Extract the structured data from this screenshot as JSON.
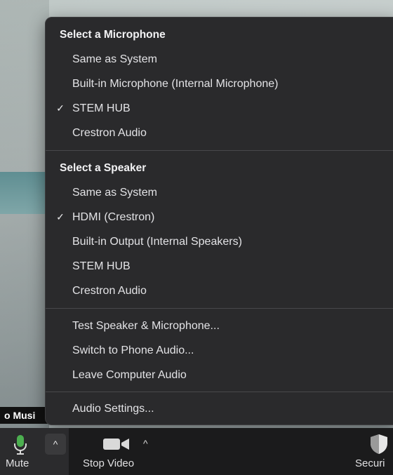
{
  "participant": {
    "name_tag": "o Musi"
  },
  "menu": {
    "microphone_section": {
      "title": "Select a Microphone",
      "items": [
        {
          "label": "Same as System",
          "checked": false
        },
        {
          "label": "Built-in Microphone (Internal Microphone)",
          "checked": false
        },
        {
          "label": "STEM HUB",
          "checked": true
        },
        {
          "label": "Crestron Audio",
          "checked": false
        }
      ]
    },
    "speaker_section": {
      "title": "Select a Speaker",
      "items": [
        {
          "label": "Same as System",
          "checked": false
        },
        {
          "label": "HDMI (Crestron)",
          "checked": true
        },
        {
          "label": "Built-in Output (Internal Speakers)",
          "checked": false
        },
        {
          "label": "STEM HUB",
          "checked": false
        },
        {
          "label": "Crestron Audio",
          "checked": false
        }
      ]
    },
    "actions": [
      {
        "label": "Test Speaker & Microphone..."
      },
      {
        "label": "Switch to Phone Audio..."
      },
      {
        "label": "Leave Computer Audio"
      }
    ],
    "settings": {
      "label": "Audio Settings..."
    },
    "check_glyph": "✓"
  },
  "toolbar": {
    "mute_label": "Mute",
    "caret_glyph": "^",
    "stop_video_label": "Stop Video",
    "security_label": "Securi",
    "icons": {
      "mic": "microphone-icon",
      "video": "video-camera-icon",
      "security": "shield-icon"
    },
    "colors": {
      "mic_green": "#4caf50"
    }
  }
}
